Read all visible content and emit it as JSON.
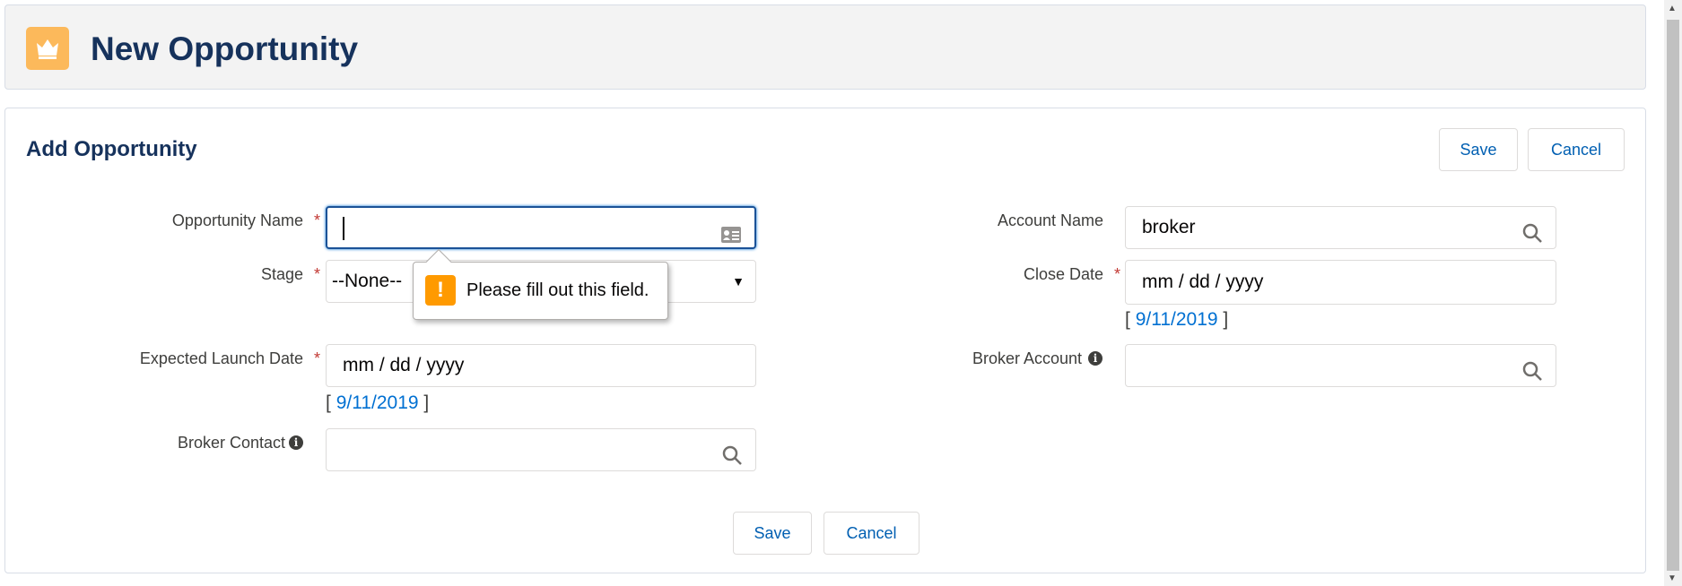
{
  "header": {
    "title": "New Opportunity",
    "icon": "crown-icon",
    "icon_color": "#fcb95b"
  },
  "card": {
    "title": "Add Opportunity",
    "save_label": "Save",
    "cancel_label": "Cancel"
  },
  "fields": {
    "opportunity_name": {
      "label": "Opportunity Name",
      "value": ""
    },
    "stage": {
      "label": "Stage",
      "value": "--None--"
    },
    "expected_launch_date": {
      "label": "Expected Launch Date",
      "placeholder": "mm / dd / yyyy",
      "today": "9/11/2019"
    },
    "broker_contact": {
      "label": "Broker Contact",
      "value": ""
    },
    "account_name": {
      "label": "Account Name",
      "value": "broker"
    },
    "close_date": {
      "label": "Close Date",
      "placeholder": "mm / dd / yyyy",
      "today": "9/11/2019"
    },
    "broker_account": {
      "label": "Broker Account",
      "value": ""
    }
  },
  "tooltip": {
    "text": "Please fill out this field."
  },
  "required_marker": "*",
  "bracket_open": "[",
  "bracket_close": "]",
  "info_glyph": "i",
  "warn_glyph": "!",
  "select_arrow": "▼",
  "scroll_up": "▲",
  "scroll_down": "▼"
}
